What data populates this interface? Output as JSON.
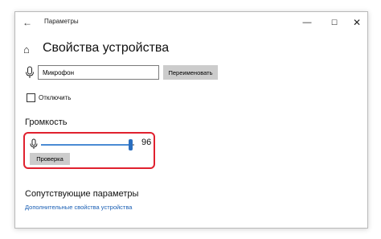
{
  "window": {
    "title": "Параметры",
    "back_icon": "arrow-left-icon",
    "controls": [
      "minimize",
      "maximize",
      "close"
    ]
  },
  "header": {
    "home_icon": "home-icon",
    "title": "Свойства устройства"
  },
  "device": {
    "name_value": "Микрофон",
    "rename_label": "Переименовать",
    "disable_label": "Отключить",
    "disable_checked": false
  },
  "volume": {
    "title": "Громкость",
    "level": 96,
    "level_text": "96",
    "test_label": "Проверка",
    "highlight_color": "#e0212f",
    "accent_color": "#2a6ebf"
  },
  "related": {
    "title": "Сопутствующие параметры",
    "link_label": "Дополнительные свойства устройства",
    "link_color": "#1a5fb4"
  }
}
